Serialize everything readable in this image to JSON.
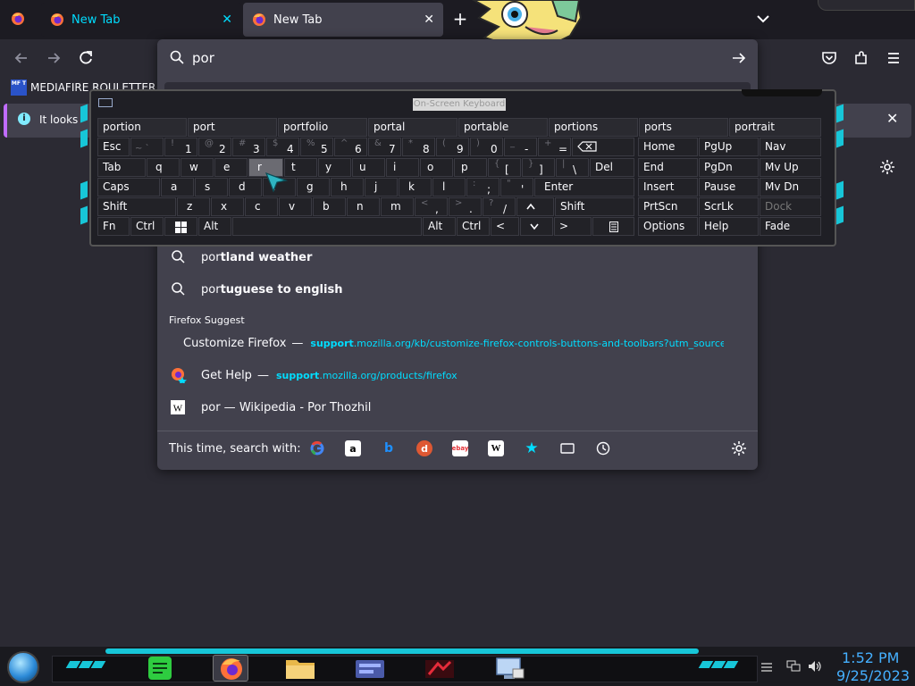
{
  "browser": {
    "tabs": [
      {
        "title": "New Tab",
        "active": false
      },
      {
        "title": "New Tab",
        "active": true
      }
    ],
    "bookmark": {
      "label": "MEDIAFIRE ROULETTER",
      "logo_text": "MF T"
    },
    "infobar_text": "It looks",
    "url_text": "por"
  },
  "suggestions": [
    {
      "prefix": "por",
      "bold": "tland weather"
    },
    {
      "prefix": "por",
      "bold": "tuguese to english"
    }
  ],
  "firefox_suggest": {
    "label": "Firefox Suggest",
    "items": [
      {
        "title": "Customize Firefox",
        "dash": "—",
        "url_bold": "support",
        "url_rest": ".mozilla.org/kb/customize-firefox-controls-buttons-and-toolbars?utm_source=fir"
      },
      {
        "title": "Get Help",
        "dash": "—",
        "url_bold": "support",
        "url_rest": ".mozilla.org/products/firefox"
      },
      {
        "title": "por — Wikipedia - Por Thozhil",
        "dash": "",
        "url_bold": "",
        "url_rest": ""
      }
    ]
  },
  "search_with_label": "This time, search with:",
  "search_engines": [
    "google-icon",
    "amazon-icon",
    "bing-icon",
    "duckduckgo-icon",
    "ebay-icon",
    "wikipedia-icon",
    "bookmarks-star-icon",
    "tabs-icon",
    "history-icon"
  ],
  "osk": {
    "title": "On-Screen Keyboard",
    "predictions": [
      "portion",
      "port",
      "portfolio",
      "portal",
      "portable",
      "portions",
      "ports",
      "portrait"
    ],
    "row1": {
      "esc": "Esc",
      "keys": [
        [
          "~ `",
          ""
        ],
        [
          "!",
          "1"
        ],
        [
          "@",
          "2"
        ],
        [
          "#",
          "3"
        ],
        [
          "$",
          "4"
        ],
        [
          "%",
          "5"
        ],
        [
          "^",
          "6"
        ],
        [
          "&",
          "7"
        ],
        [
          "*",
          "8"
        ],
        [
          "(",
          "9"
        ],
        [
          ")",
          "0"
        ],
        [
          "_",
          "-"
        ],
        [
          "+",
          "="
        ]
      ]
    },
    "row2": {
      "tab": "Tab",
      "keys": [
        "q",
        "w",
        "e",
        "r",
        "t",
        "y",
        "u",
        "i",
        "o",
        "p"
      ],
      "brackets": [
        [
          "{",
          "["
        ],
        [
          "}",
          "]"
        ],
        [
          "|",
          "\\"
        ]
      ],
      "del": "Del"
    },
    "row3": {
      "caps": "Caps",
      "keys": [
        "a",
        "s",
        "d",
        "f",
        "g",
        "h",
        "j",
        "k",
        "l"
      ],
      "punct": [
        [
          ":",
          ";"
        ],
        [
          "\"",
          "'"
        ]
      ],
      "enter": "Enter"
    },
    "row4": {
      "shift": "Shift",
      "keys": [
        "z",
        "x",
        "c",
        "v",
        "b",
        "n",
        "m"
      ],
      "punct": [
        [
          "<",
          ","
        ],
        [
          ">",
          "."
        ],
        [
          "?",
          "/"
        ]
      ],
      "shift_r": "Shift"
    },
    "row5": {
      "fn": "Fn",
      "ctrl": "Ctrl",
      "alt": "Alt",
      "alt_r": "Alt",
      "ctrl_r": "Ctrl",
      "left": "<",
      "right": ">"
    },
    "right_cols": [
      [
        "Home",
        "PgUp",
        "Nav"
      ],
      [
        "End",
        "PgDn",
        "Mv Up"
      ],
      [
        "Insert",
        "Pause",
        "Mv Dn"
      ],
      [
        "PrtScn",
        "ScrLk",
        "Dock"
      ],
      [
        "Options",
        "Help",
        "Fade"
      ]
    ]
  },
  "taskbar": {
    "time": "1:52 PM",
    "date": "9/25/2023",
    "apps": [
      "notes-app-icon",
      "firefox-icon",
      "file-explorer-icon",
      "control-panel-icon",
      "game-app-icon",
      "computer-icon"
    ]
  },
  "colors": {
    "accent": "#00ddff",
    "panel": "#42414d",
    "cyan_deco": "#17c6d8",
    "clock": "#45b0ff"
  }
}
